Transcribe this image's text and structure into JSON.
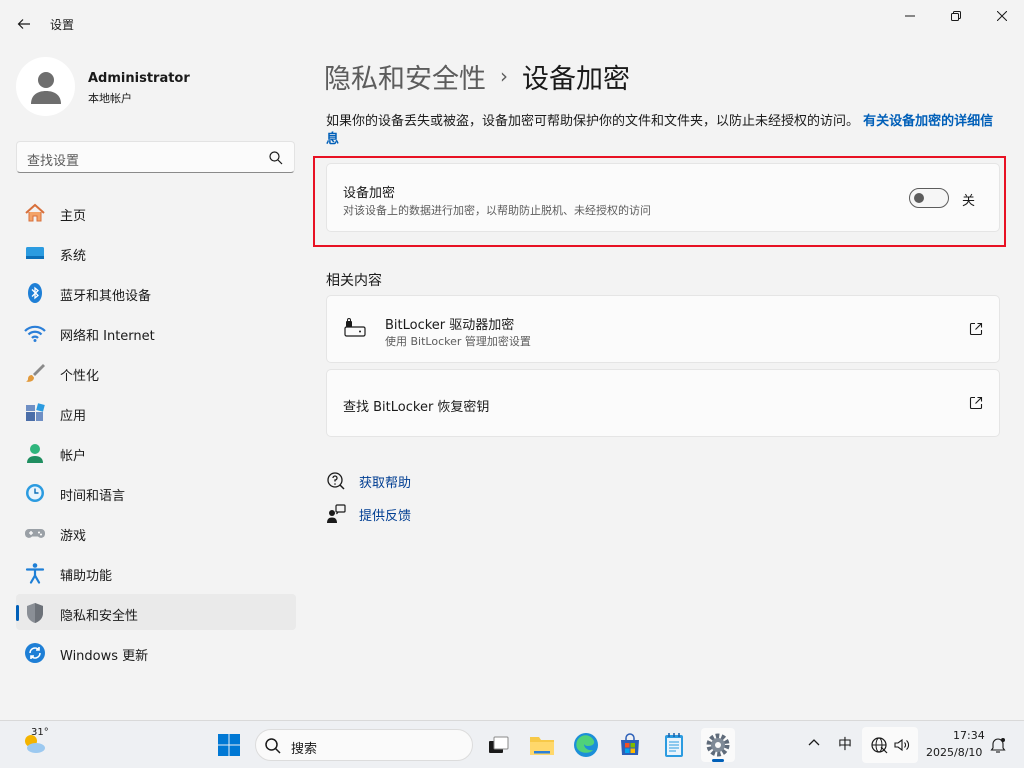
{
  "window": {
    "title": "设置"
  },
  "profile": {
    "name": "Administrator",
    "account_type": "本地帐户"
  },
  "search": {
    "placeholder": "查找设置"
  },
  "nav": {
    "items": [
      {
        "label": "主页",
        "icon": "home-icon"
      },
      {
        "label": "系统",
        "icon": "system-icon"
      },
      {
        "label": "蓝牙和其他设备",
        "icon": "bluetooth-icon"
      },
      {
        "label": "网络和 Internet",
        "icon": "wifi-icon"
      },
      {
        "label": "个性化",
        "icon": "brush-icon"
      },
      {
        "label": "应用",
        "icon": "apps-icon"
      },
      {
        "label": "帐户",
        "icon": "account-icon"
      },
      {
        "label": "时间和语言",
        "icon": "time-language-icon"
      },
      {
        "label": "游戏",
        "icon": "gamepad-icon"
      },
      {
        "label": "辅助功能",
        "icon": "accessibility-icon"
      },
      {
        "label": "隐私和安全性",
        "icon": "shield-icon"
      },
      {
        "label": "Windows 更新",
        "icon": "update-icon"
      }
    ],
    "active_index": 10
  },
  "breadcrumb": {
    "parent": "隐私和安全性",
    "separator": "›",
    "current": "设备加密"
  },
  "description": {
    "text": "如果你的设备丢失或被盗，设备加密可帮助保护你的文件和文件夹，以防止未经授权的访问。",
    "link": "有关设备加密的详细信息"
  },
  "encryption_card": {
    "title": "设备加密",
    "subtitle": "对该设备上的数据进行加密，以帮助防止脱机、未经授权的访问",
    "toggle_state": "关",
    "enabled": false
  },
  "related": {
    "title": "相关内容",
    "bitlocker": {
      "title": "BitLocker 驱动器加密",
      "subtitle": "使用 BitLocker 管理加密设置"
    },
    "recovery": {
      "title": "查找 BitLocker 恢复密钥"
    }
  },
  "help": {
    "get_help": "获取帮助",
    "feedback": "提供反馈"
  },
  "taskbar": {
    "weather_temp": "31°",
    "search_text": "搜索",
    "ime": "中",
    "time": "17:34",
    "date": "2025/8/10"
  },
  "colors": {
    "accent": "#005fb8",
    "highlight_border": "#e81123",
    "link": "#003e92"
  }
}
